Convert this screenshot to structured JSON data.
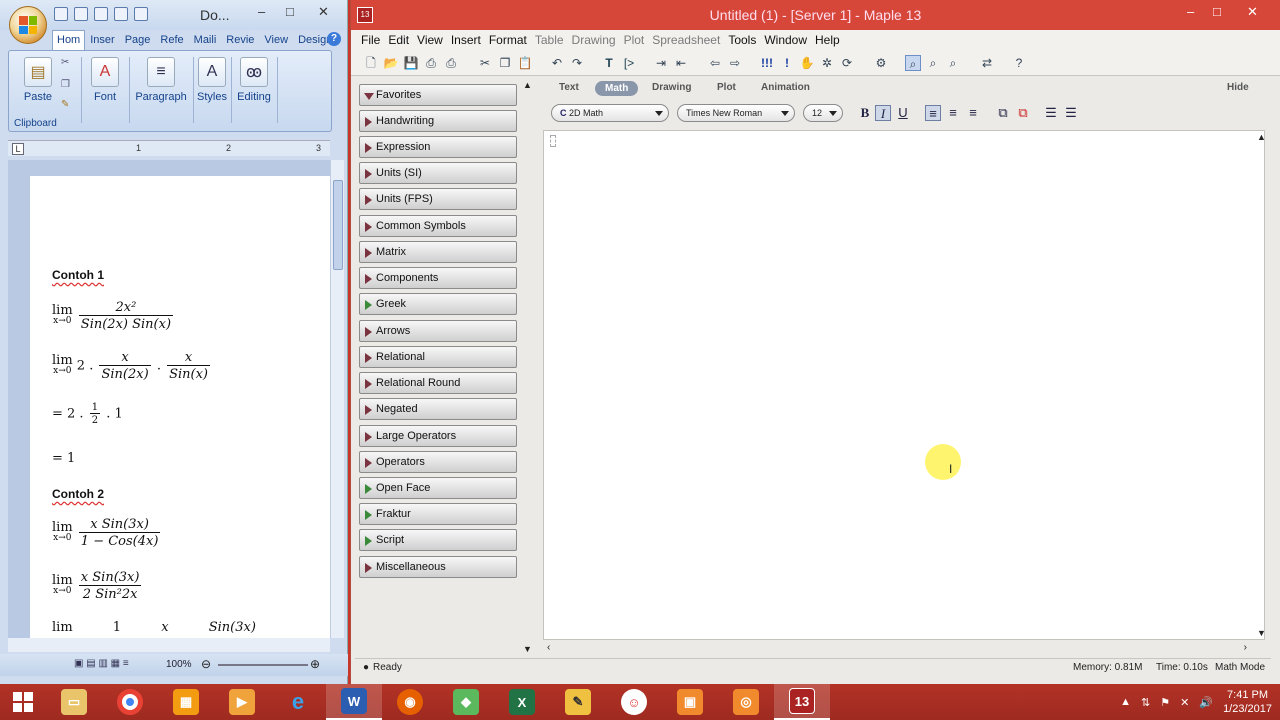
{
  "word": {
    "title": "Do...",
    "tabs": [
      "Hom",
      "Inser",
      "Page",
      "Refe",
      "Maili",
      "Revie",
      "View",
      "Design"
    ],
    "ribbon": {
      "paste": "Paste",
      "font": "Font",
      "paragraph": "Paragraph",
      "styles": "Styles",
      "editing": "Editing",
      "clipboard": "Clipboard"
    },
    "ruler_marks": [
      "1",
      "2",
      "3"
    ],
    "zoom": "100%",
    "doc": {
      "heading1": "Contoh 1",
      "ex1_l1_num": "2x²",
      "ex1_l1_den": "Sin(2x) Sin(x)",
      "ex1_l2_coef": "2 .",
      "ex1_l2_f1_num": "x",
      "ex1_l2_f1_den": "Sin(2x)",
      "ex1_l2_dot": ".",
      "ex1_l2_f2_num": "x",
      "ex1_l2_f2_den": "Sin(x)",
      "ex1_l3_pre": "= 2 .",
      "ex1_l3_num": "1",
      "ex1_l3_den": "2",
      "ex1_l3_post": ". 1",
      "ex1_l4": "= 1",
      "heading2": "Contoh 2",
      "ex2_l1_num": "x Sin(3x)",
      "ex2_l1_den": "1 − Cos(4x)",
      "ex2_l2_num": "x Sin(3x)",
      "ex2_l2_den": "2 Sin²2x",
      "ex2_l3_num1": "1",
      "ex2_l3_num2": "x",
      "ex2_l3_num3": "Sin(3x)",
      "lim": "lim",
      "lim_sub": "x→0"
    }
  },
  "maple": {
    "title": "Untitled (1) - [Server 1] - Maple 13",
    "menu": [
      "File",
      "Edit",
      "View",
      "Insert",
      "Format",
      "Table",
      "Drawing",
      "Plot",
      "Spreadsheet",
      "Tools",
      "Window",
      "Help"
    ],
    "menu_dim": [
      false,
      false,
      false,
      false,
      false,
      true,
      true,
      true,
      true,
      false,
      false,
      false
    ],
    "palettes": [
      "Favorites",
      "Handwriting",
      "Expression",
      "Units (SI)",
      "Units (FPS)",
      "Common Symbols",
      "Matrix",
      "Components",
      "Greek",
      "Arrows",
      "Relational",
      "Relational Round",
      "Negated",
      "Large Operators",
      "Operators",
      "Open Face",
      "Fraktur",
      "Script",
      "Miscellaneous"
    ],
    "context_tabs": [
      "Text",
      "Math",
      "Drawing",
      "Plot",
      "Animation"
    ],
    "hide": "Hide",
    "mode": "2D Math",
    "font": "Times New Roman",
    "size": "12",
    "bold": "B",
    "italic": "I",
    "underline": "U",
    "status": {
      "ready": "Ready",
      "memory": "Memory: 0.81M",
      "time": "Time: 0.10s",
      "mode": "Math Mode"
    }
  },
  "taskbar": {
    "time": "7:41 PM",
    "date": "1/23/2017",
    "apps": [
      "file-explorer",
      "chrome",
      "apps-grid",
      "media-player",
      "internet-explorer",
      "word",
      "firefox",
      "green-app",
      "excel",
      "tool-app",
      "red-app",
      "orange-app",
      "camera-app",
      "maple"
    ]
  }
}
